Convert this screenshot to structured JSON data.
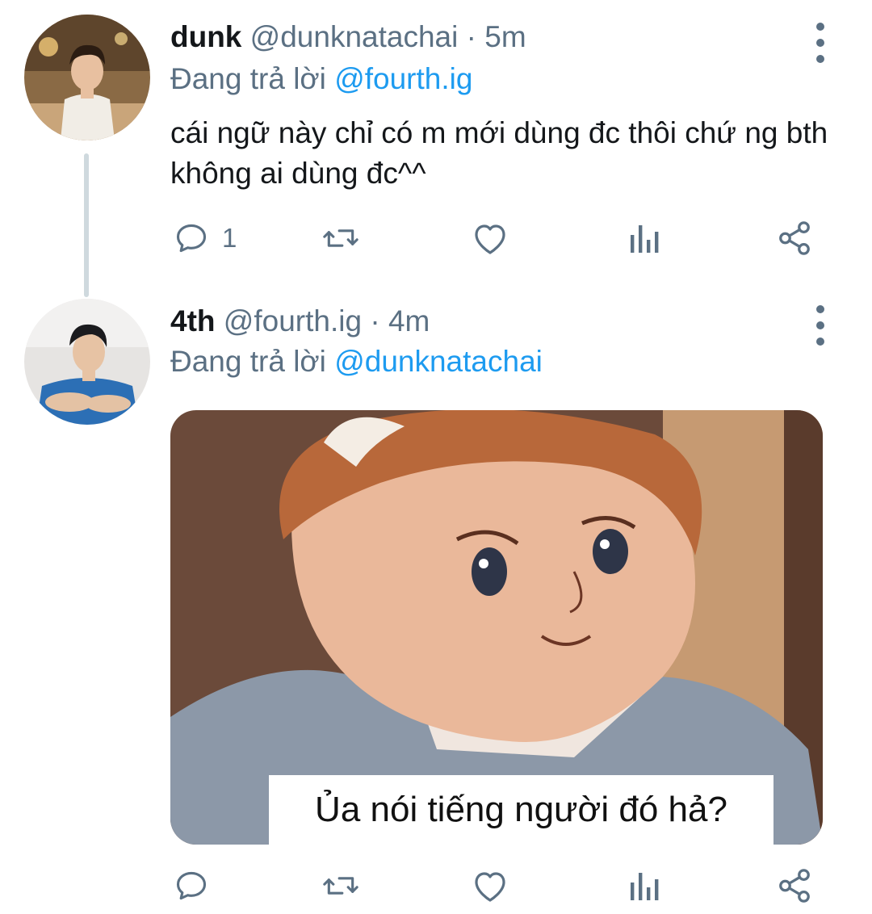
{
  "tweets": [
    {
      "display_name": "dunk",
      "handle": "@dunknatachai",
      "separator": " · ",
      "time": "5m",
      "reply_prefix": "Đang trả lời ",
      "reply_to": "@fourth.ig",
      "text": "cái ngữ này chỉ có m mới dùng đc thôi chứ ng bth không ai dùng đc^^",
      "reply_count": "1",
      "icons": [
        "reply-icon",
        "retweet-icon",
        "like-icon",
        "analytics-icon",
        "share-icon",
        "more-icon"
      ]
    },
    {
      "display_name": "4th",
      "handle": "@fourth.ig",
      "separator": " · ",
      "time": "4m",
      "reply_prefix": "Đang trả lời ",
      "reply_to": "@dunknatachai",
      "media_caption": "Ủa nói tiếng người đó hả?",
      "reply_count": "",
      "icons": [
        "reply-icon",
        "retweet-icon",
        "like-icon",
        "analytics-icon",
        "share-icon",
        "more-icon"
      ]
    }
  ],
  "colors": {
    "link": "#1d9bf0",
    "secondary_text": "#5b7083",
    "thread_line": "#cfd9de"
  }
}
